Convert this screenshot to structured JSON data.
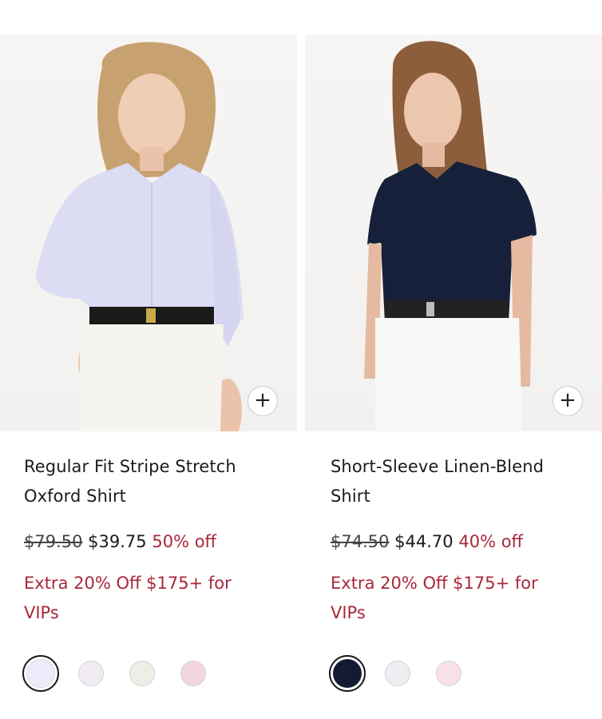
{
  "products": [
    {
      "name": "Regular Fit Stripe Stretch Oxford Shirt",
      "original_price": "$79.50",
      "sale_price": "$39.75",
      "discount": "50% off",
      "promo": "Extra 20% Off $175+ for VIPs",
      "add_button": "+",
      "swatches": [
        "#ececfa",
        "#f1ecf4",
        "#ecefe6",
        "#f2d6dd"
      ],
      "selected_swatch": 0
    },
    {
      "name": "Short-Sleeve Linen-Blend Shirt",
      "original_price": "$74.50",
      "sale_price": "$44.70",
      "discount": "40% off",
      "promo": "Extra 20% Off $175+ for VIPs",
      "add_button": "+",
      "swatches": [
        "#131a33",
        "#eceef2",
        "#f7e1e7"
      ],
      "selected_swatch": 0
    }
  ],
  "colors": {
    "accent_red": "#a8283a",
    "text": "#1b1b1b"
  }
}
